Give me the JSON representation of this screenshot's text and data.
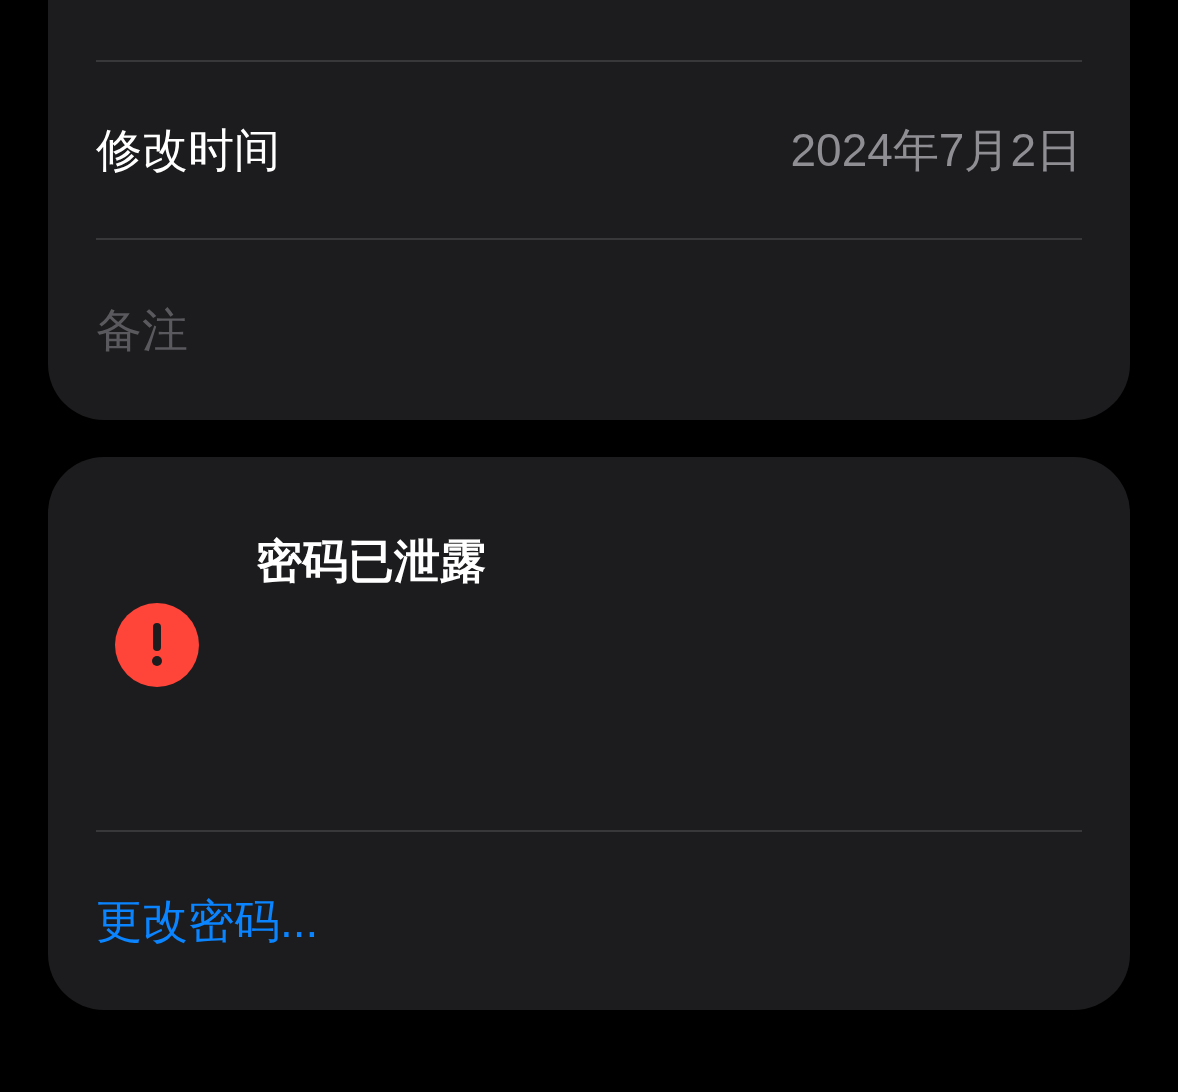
{
  "details": {
    "rows": [
      {
        "label": "修改时间",
        "value": "2024年7月2日"
      }
    ],
    "notes": {
      "placeholder": "备注"
    }
  },
  "warning": {
    "title": "密码已泄露",
    "action": "更改密码..."
  }
}
